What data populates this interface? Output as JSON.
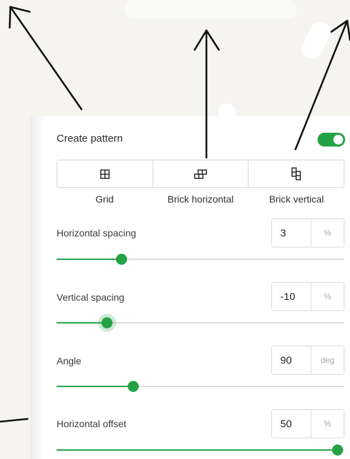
{
  "pattern": {
    "title": "Create pattern",
    "enabled": true
  },
  "layout_options": [
    {
      "label": "Grid",
      "icon": "grid-icon"
    },
    {
      "label": "Brick horizontal",
      "icon": "brick-horizontal-icon"
    },
    {
      "label": "Brick vertical",
      "icon": "brick-vertical-icon"
    }
  ],
  "fields": {
    "horizontal_spacing": {
      "label": "Horizontal spacing",
      "value": "3",
      "unit": "%",
      "slider_level": 0.225
    },
    "vertical_spacing": {
      "label": "Vertical spacing",
      "value": "-10",
      "unit": "%",
      "slider_level": 0.175
    },
    "angle": {
      "label": "Angle",
      "value": "90",
      "unit": "deg",
      "slider_level": 0.265
    },
    "horizontal_offset": {
      "label": "Horizontal offset",
      "value": "50",
      "unit": "%",
      "slider_level": 0.975
    }
  },
  "colors": {
    "accent": "#25a244",
    "track": "#dcdcdc",
    "background": "#f5f4f0"
  }
}
